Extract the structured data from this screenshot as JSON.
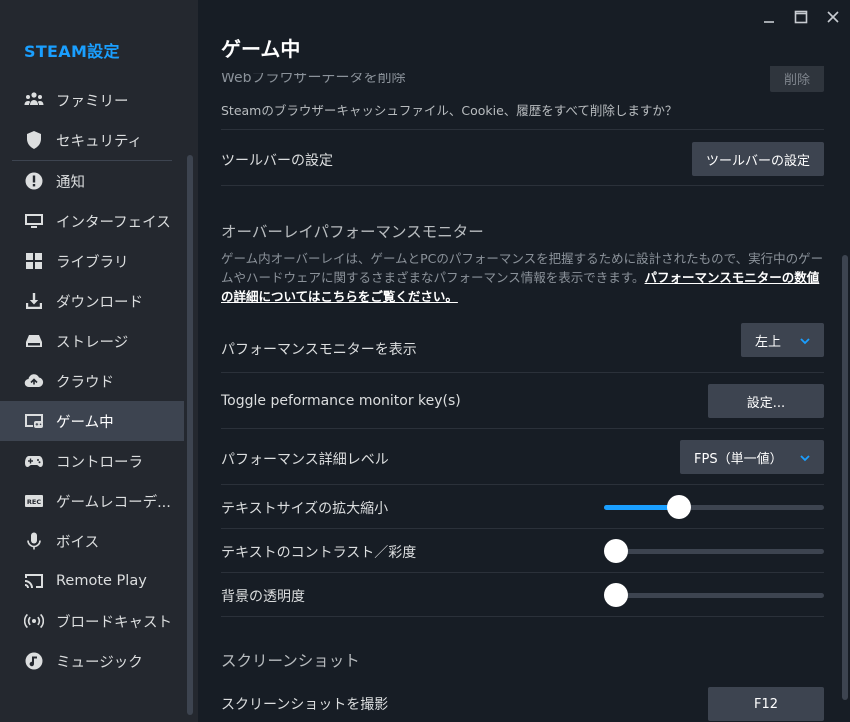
{
  "sidebar": {
    "title": "STEAM設定",
    "items": [
      {
        "label": "ファミリー",
        "icon": "family-icon"
      },
      {
        "label": "セキュリティ",
        "icon": "shield-icon"
      },
      {
        "label": "通知",
        "icon": "notification-icon"
      },
      {
        "label": "インターフェイス",
        "icon": "monitor-icon"
      },
      {
        "label": "ライブラリ",
        "icon": "grid-icon"
      },
      {
        "label": "ダウンロード",
        "icon": "download-icon"
      },
      {
        "label": "ストレージ",
        "icon": "storage-icon"
      },
      {
        "label": "クラウド",
        "icon": "cloud-icon"
      },
      {
        "label": "ゲーム中",
        "icon": "in-game-icon",
        "active": true
      },
      {
        "label": "コントローラ",
        "icon": "controller-icon"
      },
      {
        "label": "ゲームレコーデ...",
        "icon": "rec-icon"
      },
      {
        "label": "ボイス",
        "icon": "microphone-icon"
      },
      {
        "label": "Remote Play",
        "icon": "cast-icon"
      },
      {
        "label": "ブロードキャスト",
        "icon": "broadcast-icon"
      },
      {
        "label": "ミュージック",
        "icon": "music-icon"
      }
    ]
  },
  "main": {
    "title": "ゲーム中",
    "web_browser": {
      "label": "Webブラウザーデータを削除",
      "button": "削除",
      "desc": "Steamのブラウザーキャッシュファイル、Cookie、履歴をすべて削除しますか？"
    },
    "toolbar": {
      "label": "ツールバーの設定",
      "button": "ツールバーの設定"
    },
    "overlay_section": {
      "header": "オーバーレイパフォーマンスモニター",
      "desc": "ゲーム内オーバーレイは、ゲームとPCのパフォーマンスを把握するために設計されたもので、実行中のゲームやハードウェアに関するさまざまなパフォーマンス情報を表示できます。",
      "link": "パフォーマンスモニターの数値の詳細についてはこちらをご覧ください。"
    },
    "show_monitor": {
      "label": "パフォーマンスモニターを表示",
      "value": "左上"
    },
    "toggle_key": {
      "label": "Toggle peformance monitor key(s)",
      "button": "設定..."
    },
    "detail_level": {
      "label": "パフォーマンス詳細レベル",
      "value": "FPS（単一値）"
    },
    "text_size": {
      "label": "テキストサイズの拡大縮小",
      "value": 0.32
    },
    "text_contrast": {
      "label": "テキストのコントラスト／彩度",
      "value": 0.0
    },
    "bg_opacity": {
      "label": "背景の透明度",
      "value": 0.0
    },
    "screenshot_section": {
      "header": "スクリーンショット"
    },
    "take_screenshot": {
      "label": "スクリーンショットを撮影",
      "button": "F12"
    }
  },
  "colors": {
    "accent": "#1a9fff",
    "sidebar_bg": "#24282f",
    "main_bg": "#171d25",
    "button_bg": "#3d4450"
  }
}
